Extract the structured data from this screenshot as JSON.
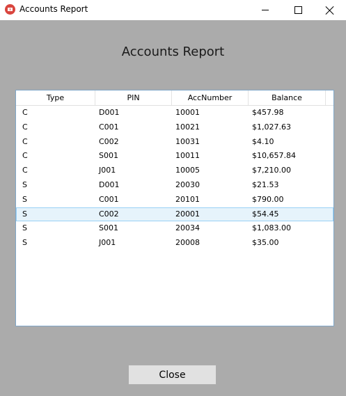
{
  "window": {
    "title": "Accounts Report",
    "icon": "app-grid-icon"
  },
  "report": {
    "title": "Accounts Report"
  },
  "table": {
    "columns": [
      "Type",
      "PIN",
      "AccNumber",
      "Balance"
    ],
    "rows": [
      [
        "C",
        "D001",
        "10001",
        "$457.98"
      ],
      [
        "C",
        "C001",
        "10021",
        "$1,027.63"
      ],
      [
        "C",
        "C002",
        "10031",
        "$4.10"
      ],
      [
        "C",
        "S001",
        "10011",
        "$10,657.84"
      ],
      [
        "C",
        "J001",
        "10005",
        "$7,210.00"
      ],
      [
        "S",
        "D001",
        "20030",
        "$21.53"
      ],
      [
        "S",
        "C001",
        "20101",
        "$790.00"
      ],
      [
        "S",
        "C002",
        "20001",
        "$54.45"
      ],
      [
        "S",
        "S001",
        "20034",
        "$1,083.00"
      ],
      [
        "S",
        "J001",
        "20008",
        "$35.00"
      ]
    ],
    "selected_row": 7
  },
  "buttons": {
    "close_label": "Close"
  }
}
